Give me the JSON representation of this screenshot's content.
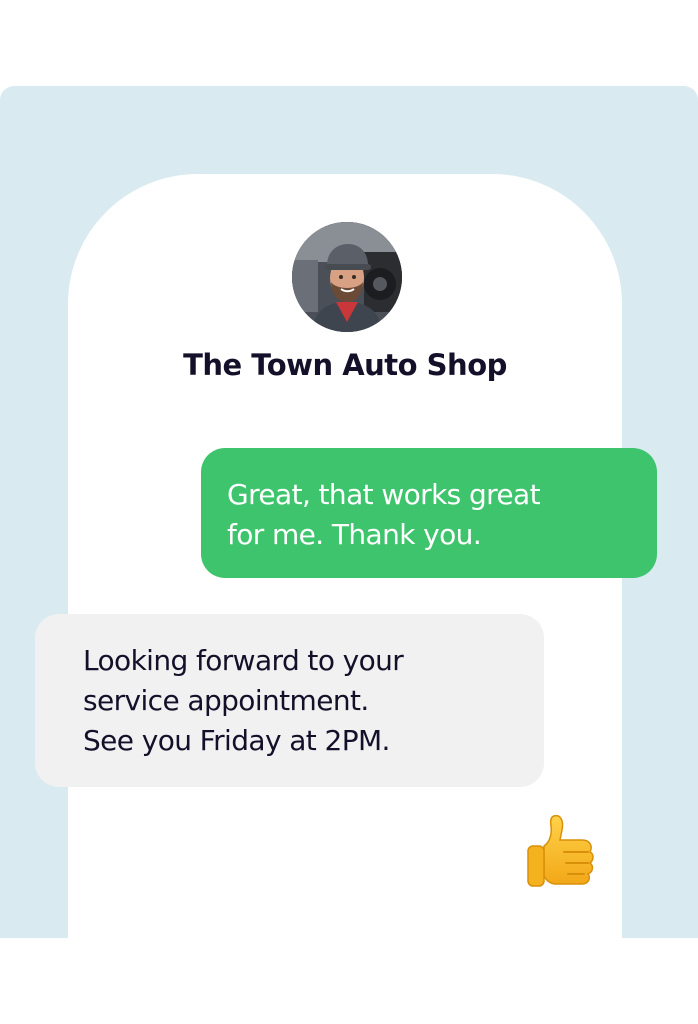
{
  "contact": {
    "name": "The Town Auto Shop",
    "avatar": "mechanic-portrait"
  },
  "messages": [
    {
      "direction": "outgoing",
      "lines": [
        "Great, that works great",
        "for me. Thank you."
      ]
    },
    {
      "direction": "incoming",
      "lines": [
        "Looking forward to your",
        "service appointment.",
        "See you Friday at 2PM."
      ]
    }
  ],
  "reaction": {
    "icon": "thumbs-up-icon"
  },
  "colors": {
    "backdrop": "#d9ebf0",
    "outgoing_bubble": "#3ec46d",
    "incoming_bubble": "#f1f1f1",
    "title_text": "#15102a"
  }
}
